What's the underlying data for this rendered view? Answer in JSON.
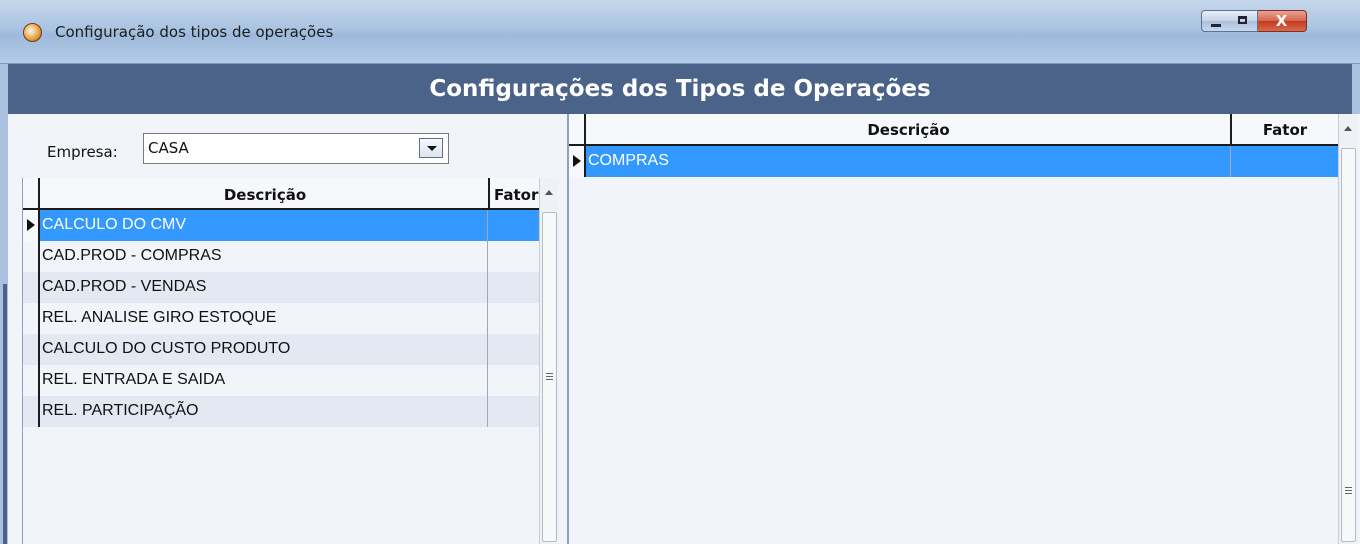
{
  "window": {
    "title": "Configuração dos tipos de operações",
    "icon": "app-icon",
    "controls": {
      "minimize": "minimize",
      "maximize": "maximize",
      "close": "X"
    }
  },
  "header": {
    "title": "Configurações dos Tipos de Operações"
  },
  "empresa": {
    "label": "Empresa:",
    "value": "CASA"
  },
  "left_grid": {
    "columns": {
      "descricao": "Descrição",
      "fator": "Fator"
    },
    "rows": [
      {
        "descricao": "CALCULO DO CMV",
        "fator": ""
      },
      {
        "descricao": "CAD.PROD - COMPRAS",
        "fator": ""
      },
      {
        "descricao": "CAD.PROD - VENDAS",
        "fator": ""
      },
      {
        "descricao": "REL. ANALISE GIRO ESTOQUE",
        "fator": ""
      },
      {
        "descricao": "CALCULO DO CUSTO PRODUTO",
        "fator": ""
      },
      {
        "descricao": "REL. ENTRADA E SAIDA",
        "fator": ""
      },
      {
        "descricao": "REL. PARTICIPAÇÃO",
        "fator": ""
      }
    ],
    "selected_index": 0
  },
  "right_grid": {
    "columns": {
      "descricao": "Descrição",
      "fator": "Fator"
    },
    "rows": [
      {
        "descricao": "COMPRAS",
        "fator": ""
      }
    ],
    "selected_index": 0
  },
  "colors": {
    "header_band": "#4b6389",
    "selection": "#3399ff",
    "background": "#f1f4f9"
  }
}
